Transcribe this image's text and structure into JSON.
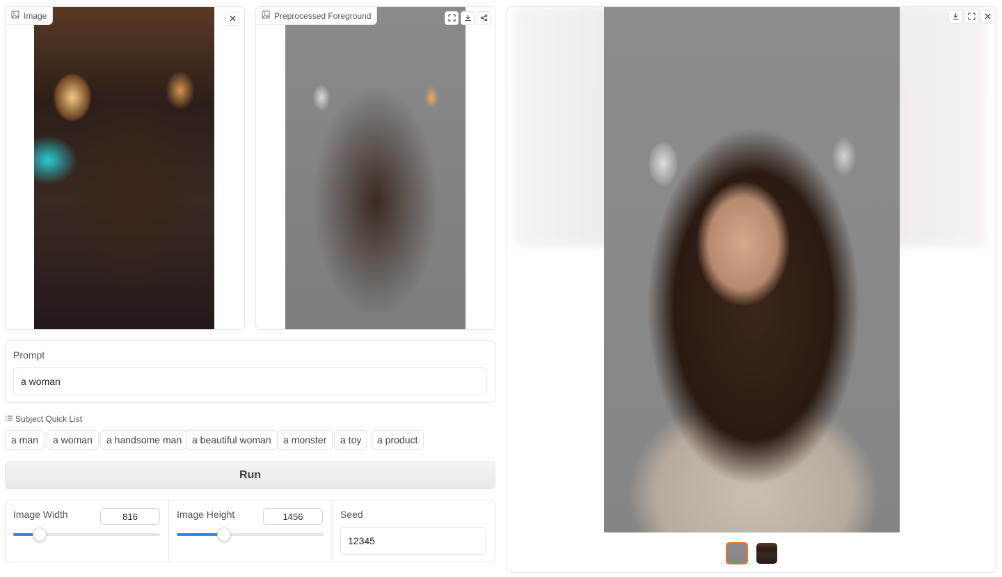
{
  "input_image": {
    "label": "Image"
  },
  "foreground": {
    "label": "Preprocessed Foreground"
  },
  "prompt": {
    "label": "Prompt",
    "value": "a woman"
  },
  "quick_list": {
    "label": "Subject Quick List",
    "items": [
      "a man",
      "a woman",
      "a handsome man",
      "a beautiful woman",
      "a monster",
      "a toy",
      "a product"
    ]
  },
  "run_label": "Run",
  "image_width": {
    "label": "Image Width",
    "value": "816",
    "slider_fraction": 0.18
  },
  "image_height": {
    "label": "Image Height",
    "value": "1456",
    "slider_fraction": 0.32
  },
  "seed": {
    "label": "Seed",
    "value": "12345"
  },
  "gallery": {
    "thumbnail_count": 2,
    "selected_index": 0
  },
  "colors": {
    "accent": "#3b82f6",
    "selected_thumb_border": "#f97316"
  },
  "icons": [
    "image-icon",
    "close-icon",
    "fullscreen-icon",
    "download-icon",
    "share-icon",
    "list-icon"
  ]
}
